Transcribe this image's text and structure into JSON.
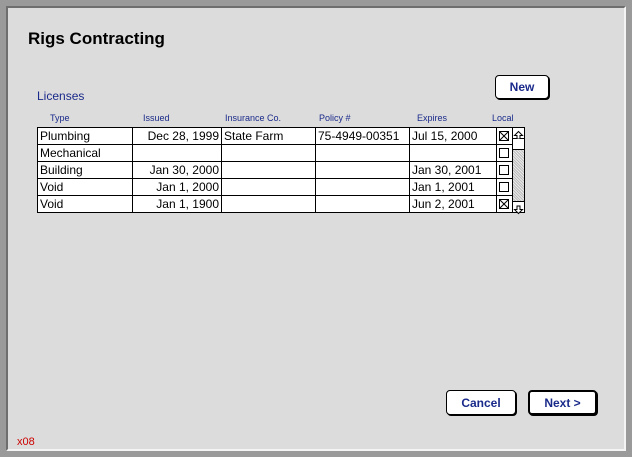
{
  "window": {
    "title": "Rigs Contracting"
  },
  "licenses": {
    "section_label": "Licenses",
    "new_button": "New",
    "columns": [
      "Type",
      "Issued",
      "Insurance Co.",
      "Policy #",
      "Expires",
      "Local"
    ],
    "rows": [
      {
        "type": "Plumbing",
        "issued": "Dec 28, 1999",
        "insurance": "State Farm",
        "policy": "75-4949-00351",
        "expires": "Jul 15, 2000",
        "local": true
      },
      {
        "type": "Mechanical",
        "issued": "",
        "insurance": "",
        "policy": "",
        "expires": "",
        "local": false
      },
      {
        "type": "Building",
        "issued": "Jan 30, 2000",
        "insurance": "",
        "policy": "",
        "expires": "Jan 30, 2001",
        "local": false
      },
      {
        "type": "Void",
        "issued": "Jan 1, 2000",
        "insurance": "",
        "policy": "",
        "expires": "Jan 1, 2001",
        "local": false
      },
      {
        "type": "Void",
        "issued": "Jan 1, 1900",
        "insurance": "",
        "policy": "",
        "expires": "Jun 2, 2001",
        "local": true
      }
    ]
  },
  "footer": {
    "cancel_button": "Cancel",
    "next_button": "Next >",
    "code": "x08"
  },
  "colors": {
    "label_blue": "#1a2a8a",
    "background": "#dcdcdc",
    "code_red": "#cc0000"
  }
}
